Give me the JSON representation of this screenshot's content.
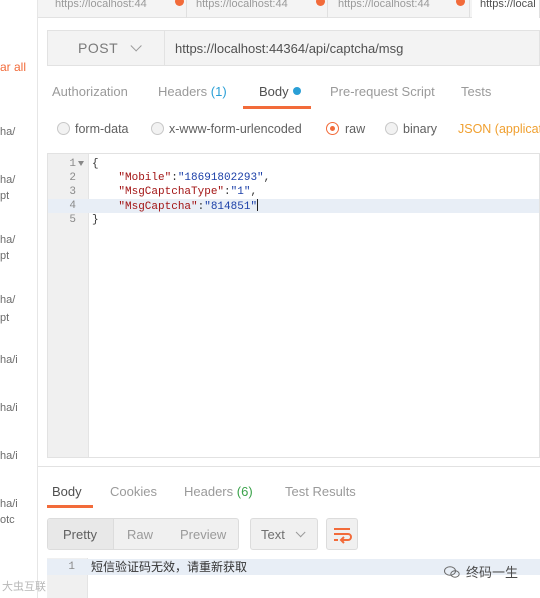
{
  "sidebar": {
    "clear_all": "ar all",
    "history": [
      "ha/",
      "ha/",
      "pt",
      "ha/",
      "pt",
      "ha/",
      "pt",
      "ha/i",
      "ha/i",
      "ha/i",
      "ha/i",
      "otc"
    ]
  },
  "tabs": [
    {
      "label": "https://localhost:44"
    },
    {
      "label": "https://localhost:44"
    },
    {
      "label": "https://localhost:44"
    },
    {
      "label": "https://local"
    }
  ],
  "request": {
    "method": "POST",
    "url": "https://localhost:44364/api/captcha/msg"
  },
  "request_tabs": {
    "authorization": "Authorization",
    "headers": "Headers",
    "headers_count": "(1)",
    "body": "Body",
    "pre_request": "Pre-request Script",
    "tests": "Tests"
  },
  "body_modes": {
    "form_data": "form-data",
    "urlencoded": "x-www-form-urlencoded",
    "raw": "raw",
    "binary": "binary",
    "content_type": "JSON (applicati"
  },
  "editor": {
    "lines": [
      {
        "num": "1",
        "open": "{"
      },
      {
        "num": "2",
        "key": "\"Mobile\"",
        "sep": ":",
        "value": "\"18691802293\"",
        "tail": ","
      },
      {
        "num": "3",
        "key": "\"MsgCaptchaType\"",
        "sep": ":",
        "value": "\"1\"",
        "tail": ","
      },
      {
        "num": "4",
        "key": "\"MsgCaptcha\"",
        "sep": ":",
        "value": "\"814851\"",
        "tail": ""
      },
      {
        "num": "5",
        "open": "}"
      }
    ]
  },
  "response_tabs": {
    "body": "Body",
    "cookies": "Cookies",
    "headers": "Headers",
    "headers_count": "(6)",
    "test_results": "Test Results"
  },
  "response_view": {
    "pretty": "Pretty",
    "raw": "Raw",
    "preview": "Preview",
    "format": "Text"
  },
  "response_body": {
    "line_num": "1",
    "text": "短信验证码无效，请重新获取"
  },
  "watermark": {
    "left": "大虫互联",
    "right": "终码一生"
  }
}
